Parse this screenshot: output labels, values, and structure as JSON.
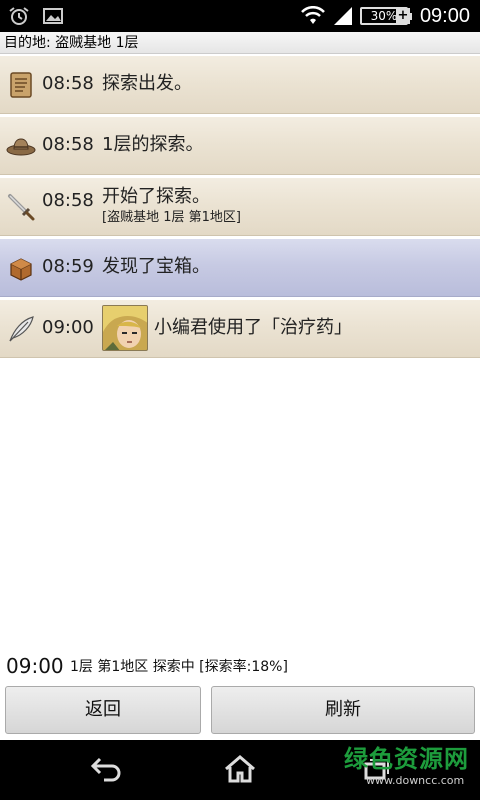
{
  "status_bar": {
    "battery": "30%",
    "charge_glyph": "+",
    "time": "09:00",
    "icons": [
      "alarm-icon",
      "image-notification-icon",
      "wifi-icon",
      "signal-icon",
      "battery-icon"
    ]
  },
  "destination": "目的地: 盗贼基地 1层",
  "log": [
    {
      "icon": "scroll-icon",
      "time": "08:58",
      "text": "探索出发。"
    },
    {
      "icon": "hat-icon",
      "time": "08:58",
      "text": "1层的探索。"
    },
    {
      "icon": "sword-icon",
      "time": "08:58",
      "text": "开始了探索。",
      "sub": "[盗贼基地 1层 第1地区]"
    },
    {
      "icon": "treasure-chest-icon",
      "time": "08:59",
      "text": "发现了宝箱。"
    },
    {
      "icon": "feather-icon",
      "time": "09:00",
      "text": "小编君使用了「治疗药」"
    }
  ],
  "footer": {
    "time": "09:00",
    "status": "1层 第1地区 探索中 [探索率:18%]"
  },
  "buttons": {
    "back": "返回",
    "refresh": "刷新"
  },
  "watermark": {
    "cn": "绿色资源网",
    "url": "www.downcc.com"
  },
  "colors": {
    "row_bg": "#ebe3d3",
    "row_highlight": "#c7cae3",
    "watermark_green": "#1d9c3c"
  }
}
